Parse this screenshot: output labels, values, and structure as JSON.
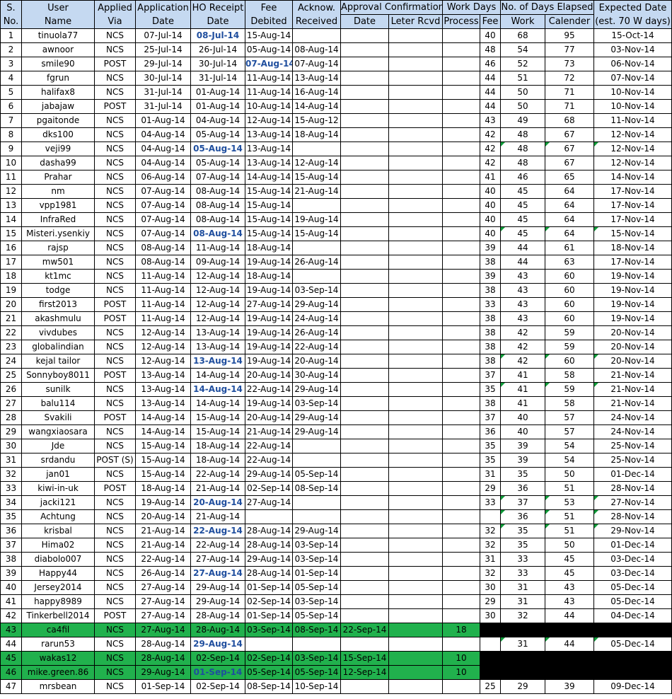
{
  "headers": {
    "sno": [
      "S.",
      "No."
    ],
    "user": [
      "User",
      "Name"
    ],
    "via": [
      "Applied",
      "Via"
    ],
    "app_date": [
      "Application",
      "Date"
    ],
    "ho_date": [
      "HO Receipt",
      "Date"
    ],
    "fee": [
      "Fee",
      "Debited"
    ],
    "ack": [
      "Acknow.",
      "Received"
    ],
    "approval": "Approval Confirmation",
    "approval_date": "Date",
    "letter_rcvd": "Leter Rcvd",
    "work_days": "Work Days",
    "process": "Process",
    "fee_days": "Fee",
    "elapsed": "No. of Days Elapsed",
    "elapsed_work": "Work",
    "elapsed_cal": "Calender",
    "expected": [
      "Expected Date",
      "(est. 70 W days)"
    ]
  },
  "rows": [
    {
      "no": "1",
      "user": "tinuola77",
      "via": "NCS",
      "app": "07-Jul-14",
      "ho": "08-Jul-14",
      "fee": "15-Aug-14",
      "ack": "",
      "adate": "",
      "letter": "",
      "proc": "",
      "feed": "40",
      "work": "68",
      "cal": "95",
      "exp": "15-Oct-14",
      "hl": [
        "ho"
      ]
    },
    {
      "no": "2",
      "user": "awnoor",
      "via": "NCS",
      "app": "25-Jul-14",
      "ho": "26-Jul-14",
      "fee": "05-Aug-14",
      "ack": "08-Aug-14",
      "adate": "",
      "letter": "",
      "proc": "",
      "feed": "48",
      "work": "54",
      "cal": "77",
      "exp": "03-Nov-14",
      "hl": []
    },
    {
      "no": "3",
      "user": "smile90",
      "via": "POST",
      "app": "29-Jul-14",
      "ho": "30-Jul-14",
      "fee": "07-Aug-14",
      "ack": "07-Aug-14",
      "adate": "",
      "letter": "",
      "proc": "",
      "feed": "46",
      "work": "52",
      "cal": "73",
      "exp": "06-Nov-14",
      "hl": [
        "fee"
      ]
    },
    {
      "no": "4",
      "user": "fgrun",
      "via": "NCS",
      "app": "30-Jul-14",
      "ho": "31-Jul-14",
      "fee": "11-Aug-14",
      "ack": "13-Aug-14",
      "adate": "",
      "letter": "",
      "proc": "",
      "feed": "44",
      "work": "51",
      "cal": "72",
      "exp": "07-Nov-14",
      "hl": []
    },
    {
      "no": "5",
      "user": "halifax8",
      "via": "NCS",
      "app": "31-Jul-14",
      "ho": "01-Aug-14",
      "fee": "11-Aug-14",
      "ack": "16-Aug-14",
      "adate": "",
      "letter": "",
      "proc": "",
      "feed": "44",
      "work": "50",
      "cal": "71",
      "exp": "10-Nov-14",
      "hl": []
    },
    {
      "no": "6",
      "user": "jabajaw",
      "via": "POST",
      "app": "31-Jul-14",
      "ho": "01-Aug-14",
      "fee": "10-Aug-14",
      "ack": "14-Aug-14",
      "adate": "",
      "letter": "",
      "proc": "",
      "feed": "44",
      "work": "50",
      "cal": "71",
      "exp": "10-Nov-14",
      "hl": []
    },
    {
      "no": "7",
      "user": "pgaitonde",
      "via": "NCS",
      "app": "01-Aug-14",
      "ho": "04-Aug-14",
      "fee": "12-Aug-14",
      "ack": "15-Aug-12",
      "adate": "",
      "letter": "",
      "proc": "",
      "feed": "43",
      "work": "49",
      "cal": "68",
      "exp": "11-Nov-14",
      "hl": []
    },
    {
      "no": "8",
      "user": "dks100",
      "via": "NCS",
      "app": "04-Aug-14",
      "ho": "05-Aug-14",
      "fee": "13-Aug-14",
      "ack": "18-Aug-14",
      "adate": "",
      "letter": "",
      "proc": "",
      "feed": "42",
      "work": "48",
      "cal": "67",
      "exp": "12-Nov-14",
      "hl": []
    },
    {
      "no": "9",
      "user": "veji99",
      "via": "NCS",
      "app": "04-Aug-14",
      "ho": "05-Aug-14",
      "fee": "13-Aug-14",
      "ack": "",
      "adate": "",
      "letter": "",
      "proc": "",
      "feed": "42",
      "work": "48",
      "cal": "67",
      "exp": "12-Nov-14",
      "hl": [
        "ho"
      ],
      "marks": [
        "work",
        "cal",
        "exp"
      ]
    },
    {
      "no": "10",
      "user": "dasha99",
      "via": "NCS",
      "app": "04-Aug-14",
      "ho": "05-Aug-14",
      "fee": "13-Aug-14",
      "ack": "12-Aug-14",
      "adate": "",
      "letter": "",
      "proc": "",
      "feed": "42",
      "work": "48",
      "cal": "67",
      "exp": "12-Nov-14",
      "hl": []
    },
    {
      "no": "11",
      "user": "Prahar",
      "via": "NCS",
      "app": "06-Aug-14",
      "ho": "07-Aug-14",
      "fee": "14-Aug-14",
      "ack": "15-Aug-14",
      "adate": "",
      "letter": "",
      "proc": "",
      "feed": "41",
      "work": "46",
      "cal": "65",
      "exp": "14-Nov-14",
      "hl": []
    },
    {
      "no": "12",
      "user": "nm",
      "via": "NCS",
      "app": "07-Aug-14",
      "ho": "08-Aug-14",
      "fee": "15-Aug-14",
      "ack": "21-Aug-14",
      "adate": "",
      "letter": "",
      "proc": "",
      "feed": "40",
      "work": "45",
      "cal": "64",
      "exp": "17-Nov-14",
      "hl": []
    },
    {
      "no": "13",
      "user": "vpp1981",
      "via": "NCS",
      "app": "07-Aug-14",
      "ho": "08-Aug-14",
      "fee": "15-Aug-14",
      "ack": "",
      "adate": "",
      "letter": "",
      "proc": "",
      "feed": "40",
      "work": "45",
      "cal": "64",
      "exp": "17-Nov-14",
      "hl": []
    },
    {
      "no": "14",
      "user": "InfraRed",
      "via": "NCS",
      "app": "07-Aug-14",
      "ho": "08-Aug-14",
      "fee": "15-Aug-14",
      "ack": "19-Aug-14",
      "adate": "",
      "letter": "",
      "proc": "",
      "feed": "40",
      "work": "45",
      "cal": "64",
      "exp": "17-Nov-14",
      "hl": []
    },
    {
      "no": "15",
      "user": "Misteri.ysenkiy",
      "via": "NCS",
      "app": "07-Aug-14",
      "ho": "08-Aug-14",
      "fee": "15-Aug-14",
      "ack": "15-Aug-14",
      "adate": "",
      "letter": "",
      "proc": "",
      "feed": "40",
      "work": "45",
      "cal": "64",
      "exp": "15-Nov-14",
      "hl": [
        "ho"
      ],
      "marks": [
        "work",
        "cal",
        "exp"
      ]
    },
    {
      "no": "16",
      "user": "rajsp",
      "via": "NCS",
      "app": "08-Aug-14",
      "ho": "11-Aug-14",
      "fee": "18-Aug-14",
      "ack": "",
      "adate": "",
      "letter": "",
      "proc": "",
      "feed": "39",
      "work": "44",
      "cal": "61",
      "exp": "18-Nov-14",
      "hl": []
    },
    {
      "no": "17",
      "user": "mw501",
      "via": "NCS",
      "app": "08-Aug-14",
      "ho": "09-Aug-14",
      "fee": "19-Aug-14",
      "ack": "26-Aug-14",
      "adate": "",
      "letter": "",
      "proc": "",
      "feed": "38",
      "work": "44",
      "cal": "63",
      "exp": "17-Nov-14",
      "hl": []
    },
    {
      "no": "18",
      "user": "kt1mc",
      "via": "NCS",
      "app": "11-Aug-14",
      "ho": "12-Aug-14",
      "fee": "18-Aug-14",
      "ack": "",
      "adate": "",
      "letter": "",
      "proc": "",
      "feed": "39",
      "work": "43",
      "cal": "60",
      "exp": "19-Nov-14",
      "hl": []
    },
    {
      "no": "19",
      "user": "todge",
      "via": "NCS",
      "app": "11-Aug-14",
      "ho": "12-Aug-14",
      "fee": "19-Aug-14",
      "ack": "03-Sep-14",
      "adate": "",
      "letter": "",
      "proc": "",
      "feed": "38",
      "work": "43",
      "cal": "60",
      "exp": "19-Nov-14",
      "hl": []
    },
    {
      "no": "20",
      "user": "first2013",
      "via": "POST",
      "app": "11-Aug-14",
      "ho": "12-Aug-14",
      "fee": "27-Aug-14",
      "ack": "29-Aug-14",
      "adate": "",
      "letter": "",
      "proc": "",
      "feed": "33",
      "work": "43",
      "cal": "60",
      "exp": "19-Nov-14",
      "hl": []
    },
    {
      "no": "21",
      "user": "akashmulu",
      "via": "POST",
      "app": "11-Aug-14",
      "ho": "12-Aug-14",
      "fee": "19-Aug-14",
      "ack": "24-Aug-14",
      "adate": "",
      "letter": "",
      "proc": "",
      "feed": "38",
      "work": "43",
      "cal": "60",
      "exp": "19-Nov-14",
      "hl": []
    },
    {
      "no": "22",
      "user": "vivdubes",
      "via": "NCS",
      "app": "12-Aug-14",
      "ho": "13-Aug-14",
      "fee": "19-Aug-14",
      "ack": "26-Aug-14",
      "adate": "",
      "letter": "",
      "proc": "",
      "feed": "38",
      "work": "42",
      "cal": "59",
      "exp": "20-Nov-14",
      "hl": []
    },
    {
      "no": "23",
      "user": "globalindian",
      "via": "NCS",
      "app": "12-Aug-14",
      "ho": "13-Aug-14",
      "fee": "19-Aug-14",
      "ack": "22-Aug-14",
      "adate": "",
      "letter": "",
      "proc": "",
      "feed": "38",
      "work": "42",
      "cal": "59",
      "exp": "20-Nov-14",
      "hl": []
    },
    {
      "no": "24",
      "user": "kejal  tailor",
      "via": "NCS",
      "app": "12-Aug-14",
      "ho": "13-Aug-14",
      "fee": "19-Aug-14",
      "ack": "20-Aug-14",
      "adate": "",
      "letter": "",
      "proc": "",
      "feed": "38",
      "work": "42",
      "cal": "60",
      "exp": "20-Nov-14",
      "hl": [
        "ho"
      ],
      "marks": [
        "work",
        "cal",
        "exp"
      ]
    },
    {
      "no": "25",
      "user": "Sonnyboy8011",
      "via": "POST",
      "app": "13-Aug-14",
      "ho": "14-Aug-14",
      "fee": "20-Aug-14",
      "ack": "30-Aug-14",
      "adate": "",
      "letter": "",
      "proc": "",
      "feed": "37",
      "work": "41",
      "cal": "58",
      "exp": "21-Nov-14",
      "hl": []
    },
    {
      "no": "26",
      "user": "sunilk",
      "via": "NCS",
      "app": "13-Aug-14",
      "ho": "14-Aug-14",
      "fee": "22-Aug-14",
      "ack": "29-Aug-14",
      "adate": "",
      "letter": "",
      "proc": "",
      "feed": "35",
      "work": "41",
      "cal": "59",
      "exp": "21-Nov-14",
      "hl": [
        "ho"
      ],
      "marks": [
        "work",
        "cal",
        "exp"
      ]
    },
    {
      "no": "27",
      "user": "balu114",
      "via": "NCS",
      "app": "13-Aug-14",
      "ho": "14-Aug-14",
      "fee": "19-Aug-14",
      "ack": "03-Sep-14",
      "adate": "",
      "letter": "",
      "proc": "",
      "feed": "38",
      "work": "41",
      "cal": "58",
      "exp": "21-Nov-14",
      "hl": []
    },
    {
      "no": "28",
      "user": "Svakili",
      "via": "POST",
      "app": "14-Aug-14",
      "ho": "15-Aug-14",
      "fee": "20-Aug-14",
      "ack": "29-Aug-14",
      "adate": "",
      "letter": "",
      "proc": "",
      "feed": "37",
      "work": "40",
      "cal": "57",
      "exp": "24-Nov-14",
      "hl": []
    },
    {
      "no": "29",
      "user": "wangxiaosara",
      "via": "NCS",
      "app": "14-Aug-14",
      "ho": "15-Aug-14",
      "fee": "21-Aug-14",
      "ack": "29-Aug-14",
      "adate": "",
      "letter": "",
      "proc": "",
      "feed": "36",
      "work": "40",
      "cal": "57",
      "exp": "24-Nov-14",
      "hl": []
    },
    {
      "no": "30",
      "user": "Jde",
      "via": "NCS",
      "app": "15-Aug-14",
      "ho": "18-Aug-14",
      "fee": "22-Aug-14",
      "ack": "",
      "adate": "",
      "letter": "",
      "proc": "",
      "feed": "35",
      "work": "39",
      "cal": "54",
      "exp": "25-Nov-14",
      "hl": []
    },
    {
      "no": "31",
      "user": "srdandu",
      "via": "POST (S)",
      "app": "15-Aug-14",
      "ho": "18-Aug-14",
      "fee": "22-Aug-14",
      "ack": "",
      "adate": "",
      "letter": "",
      "proc": "",
      "feed": "35",
      "work": "39",
      "cal": "54",
      "exp": "25-Nov-14",
      "hl": []
    },
    {
      "no": "32",
      "user": "jan01",
      "via": "NCS",
      "app": "15-Aug-14",
      "ho": "22-Aug-14",
      "fee": "29-Aug-14",
      "ack": "05-Sep-14",
      "adate": "",
      "letter": "",
      "proc": "",
      "feed": "31",
      "work": "35",
      "cal": "50",
      "exp": "01-Dec-14",
      "hl": []
    },
    {
      "no": "33",
      "user": "kiwi-in-uk",
      "via": "POST",
      "app": "18-Aug-14",
      "ho": "21-Aug-14",
      "fee": "02-Sep-14",
      "ack": "08-Sep-14",
      "adate": "",
      "letter": "",
      "proc": "",
      "feed": "29",
      "work": "36",
      "cal": "51",
      "exp": "28-Nov-14",
      "hl": []
    },
    {
      "no": "34",
      "user": "jacki121",
      "via": "NCS",
      "app": "19-Aug-14",
      "ho": "20-Aug-14",
      "fee": "27-Aug-14",
      "ack": "",
      "adate": "",
      "letter": "",
      "proc": "",
      "feed": "33",
      "work": "37",
      "cal": "53",
      "exp": "27-Nov-14",
      "hl": [
        "ho"
      ],
      "marks": [
        "work",
        "cal",
        "exp"
      ]
    },
    {
      "no": "35",
      "user": "Achtung",
      "via": "NCS",
      "app": "20-Aug-14",
      "ho": "21-Aug-14",
      "fee": "",
      "ack": "",
      "adate": "",
      "letter": "",
      "proc": "",
      "feed": "",
      "work": "36",
      "cal": "51",
      "exp": "28-Nov-14",
      "hl": [],
      "marks": [
        "work",
        "cal",
        "exp"
      ]
    },
    {
      "no": "36",
      "user": "krisbal",
      "via": "NCS",
      "app": "21-Aug-14",
      "ho": "22-Aug-14",
      "fee": "28-Aug-14",
      "ack": "29-Aug-14",
      "adate": "",
      "letter": "",
      "proc": "",
      "feed": "32",
      "work": "35",
      "cal": "51",
      "exp": "29-Nov-14",
      "hl": [
        "ho"
      ],
      "marks": [
        "work",
        "cal",
        "exp"
      ]
    },
    {
      "no": "37",
      "user": "Hima02",
      "via": "NCS",
      "app": "21-Aug-14",
      "ho": "22-Aug-14",
      "fee": "28-Aug-14",
      "ack": "03-Sep-14",
      "adate": "",
      "letter": "",
      "proc": "",
      "feed": "32",
      "work": "35",
      "cal": "50",
      "exp": "01-Dec-14",
      "hl": []
    },
    {
      "no": "38",
      "user": "diabolo007",
      "via": "NCS",
      "app": "22-Aug-14",
      "ho": "27-Aug-14",
      "fee": "29-Aug-14",
      "ack": "03-Sep-14",
      "adate": "",
      "letter": "",
      "proc": "",
      "feed": "31",
      "work": "33",
      "cal": "45",
      "exp": "03-Dec-14",
      "hl": []
    },
    {
      "no": "39",
      "user": "Happy44",
      "via": "NCS",
      "app": "26-Aug-14",
      "ho": "27-Aug-14",
      "fee": "28-Aug-14",
      "ack": "01-Sep-14",
      "adate": "",
      "letter": "",
      "proc": "",
      "feed": "32",
      "work": "33",
      "cal": "45",
      "exp": "03-Dec-14",
      "hl": [
        "ho"
      ]
    },
    {
      "no": "40",
      "user": "Jersey2014",
      "via": "NCS",
      "app": "27-Aug-14",
      "ho": "29-Aug-14",
      "fee": "01-Sep-14",
      "ack": "05-Sep-14",
      "adate": "",
      "letter": "",
      "proc": "",
      "feed": "30",
      "work": "31",
      "cal": "43",
      "exp": "05-Dec-14",
      "hl": []
    },
    {
      "no": "41",
      "user": "happy8989",
      "via": "NCS",
      "app": "27-Aug-14",
      "ho": "29-Aug-14",
      "fee": "02-Sep-14",
      "ack": "03-Sep-14",
      "adate": "",
      "letter": "",
      "proc": "",
      "feed": "29",
      "work": "31",
      "cal": "43",
      "exp": "05-Dec-14",
      "hl": []
    },
    {
      "no": "42",
      "user": "Tinkerbell2014",
      "via": "POST",
      "app": "27-Aug-14",
      "ho": "28-Aug-14",
      "fee": "01-Sep-14",
      "ack": "05-Sep-14",
      "adate": "",
      "letter": "",
      "proc": "",
      "feed": "30",
      "work": "32",
      "cal": "44",
      "exp": "04-Dec-14",
      "hl": []
    },
    {
      "no": "43",
      "user": "ca4fil",
      "via": "NCS",
      "app": "27-Aug-14",
      "ho": "28-Aug-14",
      "fee": "03-Sep-14",
      "ack": "08-Sep-14",
      "adate": "22-Sep-14",
      "letter": "",
      "proc": "18",
      "feed": "",
      "work": "",
      "cal": "",
      "exp": "",
      "hl": [],
      "green": true,
      "black": true
    },
    {
      "no": "44",
      "user": "rarun53",
      "via": "NCS",
      "app": "28-Aug-14",
      "ho": "29-Aug-14",
      "fee": "",
      "ack": "",
      "adate": "",
      "letter": "",
      "proc": "",
      "feed": "",
      "work": "31",
      "cal": "44",
      "exp": "05-Dec-14",
      "hl": [
        "ho"
      ],
      "marks": [
        "work",
        "cal",
        "exp"
      ]
    },
    {
      "no": "45",
      "user": "wakas12",
      "via": "NCS",
      "app": "28-Aug-14",
      "ho": "02-Sep-14",
      "fee": "02-Sep-14",
      "ack": "03-Sep-14",
      "adate": "15-Sep-14",
      "letter": "",
      "proc": "10",
      "feed": "",
      "work": "",
      "cal": "",
      "exp": "",
      "hl": [],
      "green": true,
      "black": true
    },
    {
      "no": "46",
      "user": "mike.green.86",
      "via": "NCS",
      "app": "29-Aug-14",
      "ho": "01-Sep-14",
      "fee": "05-Sep-14",
      "ack": "05-Sep-14",
      "adate": "12-Sep-14",
      "letter": "",
      "proc": "10",
      "feed": "",
      "work": "",
      "cal": "",
      "exp": "",
      "hl": [
        "ho"
      ],
      "green": true,
      "black": true
    },
    {
      "no": "47",
      "user": "mrsbean",
      "via": "NCS",
      "app": "01-Sep-14",
      "ho": "02-Sep-14",
      "fee": "08-Sep-14",
      "ack": "10-Sep-14",
      "adate": "",
      "letter": "",
      "proc": "",
      "feed": "25",
      "work": "29",
      "cal": "39",
      "exp": "09-Dec-14",
      "hl": []
    }
  ]
}
